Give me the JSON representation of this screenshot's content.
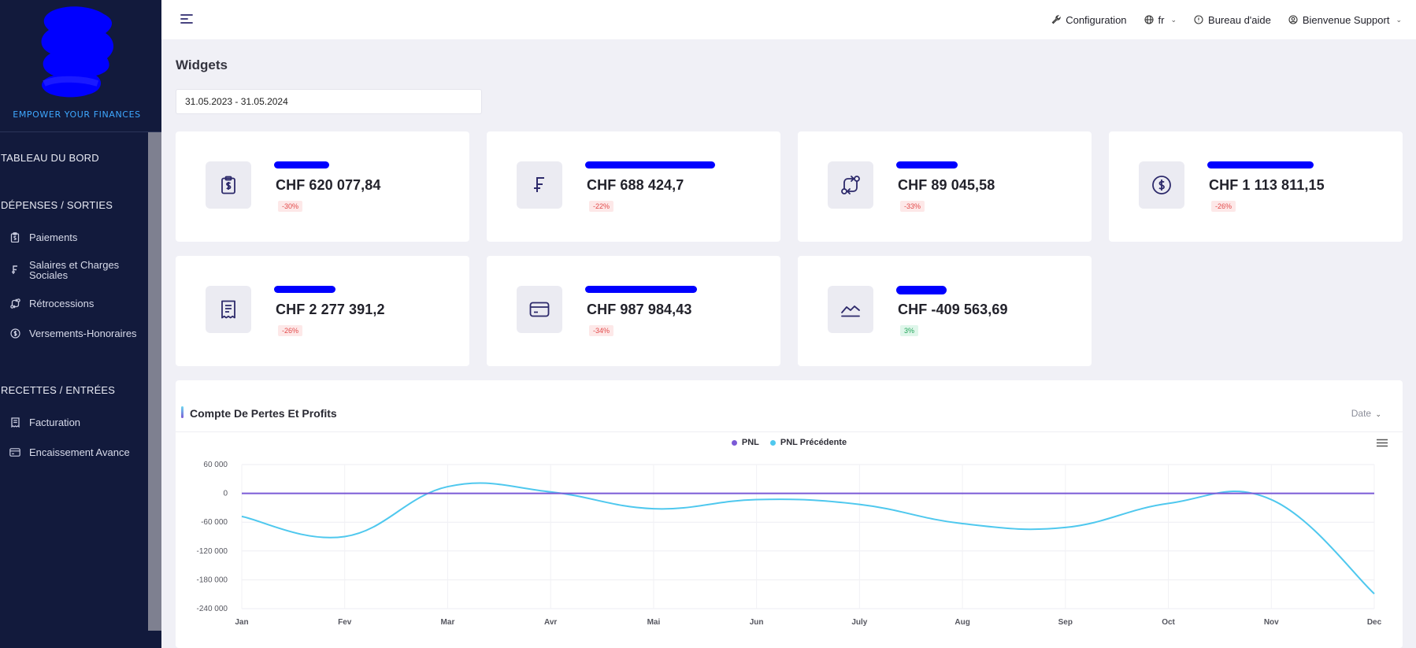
{
  "sidebar": {
    "tagline": "EMPOWER YOUR FINANCES",
    "sections": [
      {
        "title": "TABLEAU DU BORD",
        "items": []
      },
      {
        "title": "DÉPENSES / SORTIES",
        "items": [
          {
            "label": "Paiements",
            "icon": "clipboard-dollar-icon"
          },
          {
            "label": "Salaires et Charges Sociales",
            "icon": "franc-icon"
          },
          {
            "label": "Rétrocessions",
            "icon": "transfer-icon"
          },
          {
            "label": "Versements-Honoraires",
            "icon": "coin-dollar-icon"
          }
        ]
      },
      {
        "title": "RECETTES / ENTRÉES",
        "items": [
          {
            "label": "Facturation",
            "icon": "receipt-icon"
          },
          {
            "label": "Encaissement Avance",
            "icon": "credit-card-icon"
          }
        ]
      }
    ]
  },
  "topbar": {
    "configuration": "Configuration",
    "language": "fr",
    "help": "Bureau d'aide",
    "user": "Bienvenue Support"
  },
  "page": {
    "title": "Widgets",
    "date_range": "31.05.2023 - 31.05.2024"
  },
  "cards": [
    {
      "value": "CHF 620 077,84",
      "change": "-30%",
      "trend": "neg",
      "icon": "clipboard-dollar-icon"
    },
    {
      "value": "CHF 688 424,7",
      "change": "-22%",
      "trend": "neg",
      "icon": "franc-icon"
    },
    {
      "value": "CHF 89 045,58",
      "change": "-33%",
      "trend": "neg",
      "icon": "transfer-icon"
    },
    {
      "value": "CHF 1 113 811,15",
      "change": "-26%",
      "trend": "neg",
      "icon": "coin-dollar-icon"
    },
    {
      "value": "CHF 2 277 391,2",
      "change": "-26%",
      "trend": "neg",
      "icon": "receipt-icon"
    },
    {
      "value": "CHF 987 984,43",
      "change": "-34%",
      "trend": "neg",
      "icon": "credit-card-icon"
    },
    {
      "value": "CHF -409 563,69",
      "change": "3%",
      "trend": "pos",
      "icon": "line-chart-icon"
    }
  ],
  "chart": {
    "title": "Compte De Pertes Et Profits",
    "filter_label": "Date"
  },
  "chart_data": {
    "type": "line",
    "title": "Compte De Pertes Et Profits",
    "categories": [
      "Jan",
      "Fev",
      "Mar",
      "Avr",
      "Mai",
      "Jun",
      "July",
      "Aug",
      "Sep",
      "Oct",
      "Nov",
      "Dec"
    ],
    "series": [
      {
        "name": "PNL",
        "color": "#7b5ad6",
        "values": [
          0,
          0,
          0,
          0,
          0,
          0,
          0,
          0,
          0,
          0,
          0,
          0
        ]
      },
      {
        "name": "PNL Précédente",
        "color": "#4fc8ee",
        "values": [
          -48000,
          -90000,
          14000,
          3000,
          -32000,
          -13000,
          -23000,
          -63000,
          -71000,
          -21000,
          -13000,
          -209000
        ]
      }
    ],
    "y_ticks": [
      60000,
      0,
      -60000,
      -120000,
      -180000,
      -240000
    ],
    "y_tick_labels": [
      "60 000",
      "0",
      "-60 000",
      "-120 000",
      "-180 000",
      "-240 000"
    ],
    "ylim": [
      -240000,
      60000
    ],
    "grid": true,
    "legend_position": "top-center"
  }
}
